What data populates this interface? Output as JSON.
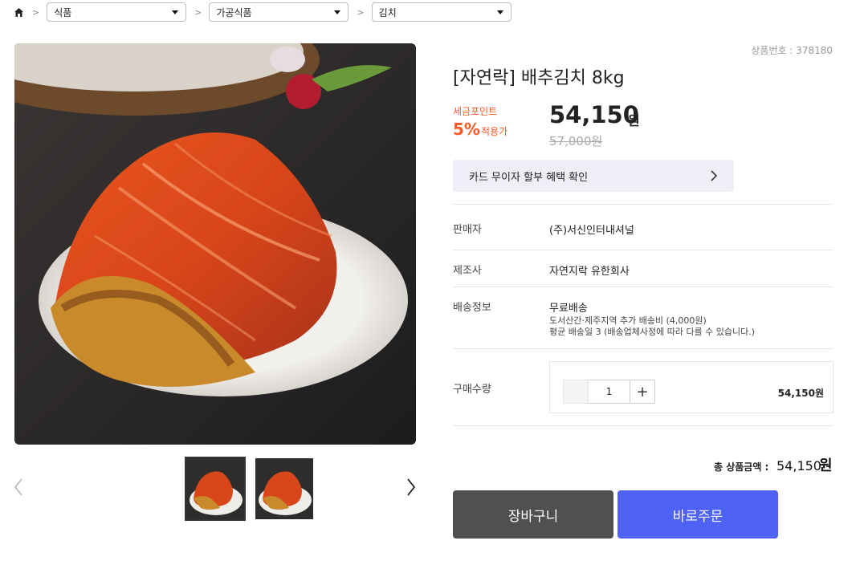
{
  "breadcrumb": {
    "home_icon": "home-icon",
    "separator": ">",
    "categories": [
      "식품",
      "가공식품",
      "김치"
    ]
  },
  "product": {
    "number_text": "상품번호 : 378180",
    "title": "[자연락] 배추김치 8kg",
    "point_label": "세금포인트",
    "point_percent": "5%",
    "point_suffix": "적용가",
    "price": "54,150",
    "price_unit": "원",
    "original_price": "57,000원",
    "card_benefit_label": "카드 무이자 할부 혜택 확인"
  },
  "details": {
    "seller_label": "판매자",
    "seller_value": "(주)서신인터내셔널",
    "maker_label": "제조사",
    "maker_value": "자연지락 유한회사",
    "shipping_label": "배송정보",
    "shipping_main": "무료배송",
    "shipping_extra": "도서산간·제주지역 추가 배송비 (4,000원)",
    "shipping_days": "평균 배송일 3 (배송업체사정에 따라 다를 수 있습니다.)",
    "qty_label": "구매수량"
  },
  "quantity": {
    "value": "1",
    "plus": "+",
    "line_total": "54,150원"
  },
  "total": {
    "label": "총 상품금액 :",
    "amount": "54,150",
    "unit": "원"
  },
  "actions": {
    "cart_label": "장바구니",
    "buy_label": "바로주문"
  },
  "colors": {
    "accent": "#4f62f6",
    "point": "#ff5722",
    "cart": "#505050"
  }
}
